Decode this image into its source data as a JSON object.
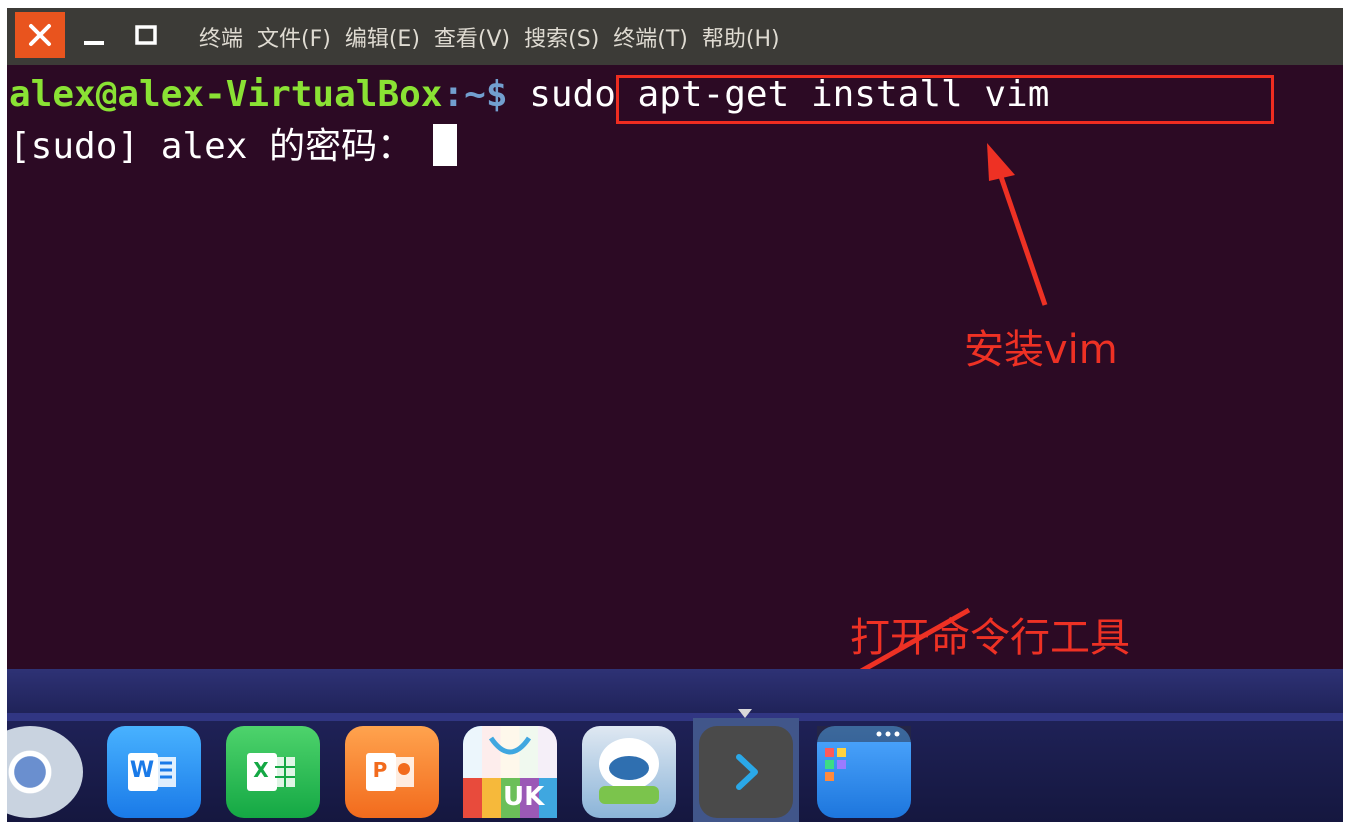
{
  "menu": {
    "items": [
      "终端",
      "文件(F)",
      "编辑(E)",
      "查看(V)",
      "搜索(S)",
      "终端(T)",
      "帮助(H)"
    ]
  },
  "terminal": {
    "prompt_user": "alex@alex-VirtualBox",
    "prompt_path": ":~$",
    "command": " sudo apt-get install vim",
    "line2": "[sudo] alex 的密码："
  },
  "annotations": {
    "install_label": "安装vim",
    "open_label": "打开命令行工具"
  },
  "dock": {
    "word_letter": "W",
    "excel_letter": "X",
    "ppt_letter": "P",
    "store_letter": "UK"
  },
  "colors": {
    "terminal_bg": "#2c0a24",
    "prompt_user": "#8ae234",
    "prompt_path": "#729fcf",
    "annotation_red": "#ee3124",
    "close_button": "#e9541e"
  },
  "icons": [
    "close-icon",
    "minimize-icon",
    "maximize-icon",
    "browser-icon",
    "word-icon",
    "excel-icon",
    "ppt-icon",
    "software-store-icon",
    "assistant-icon",
    "terminal-icon",
    "file-manager-icon"
  ]
}
